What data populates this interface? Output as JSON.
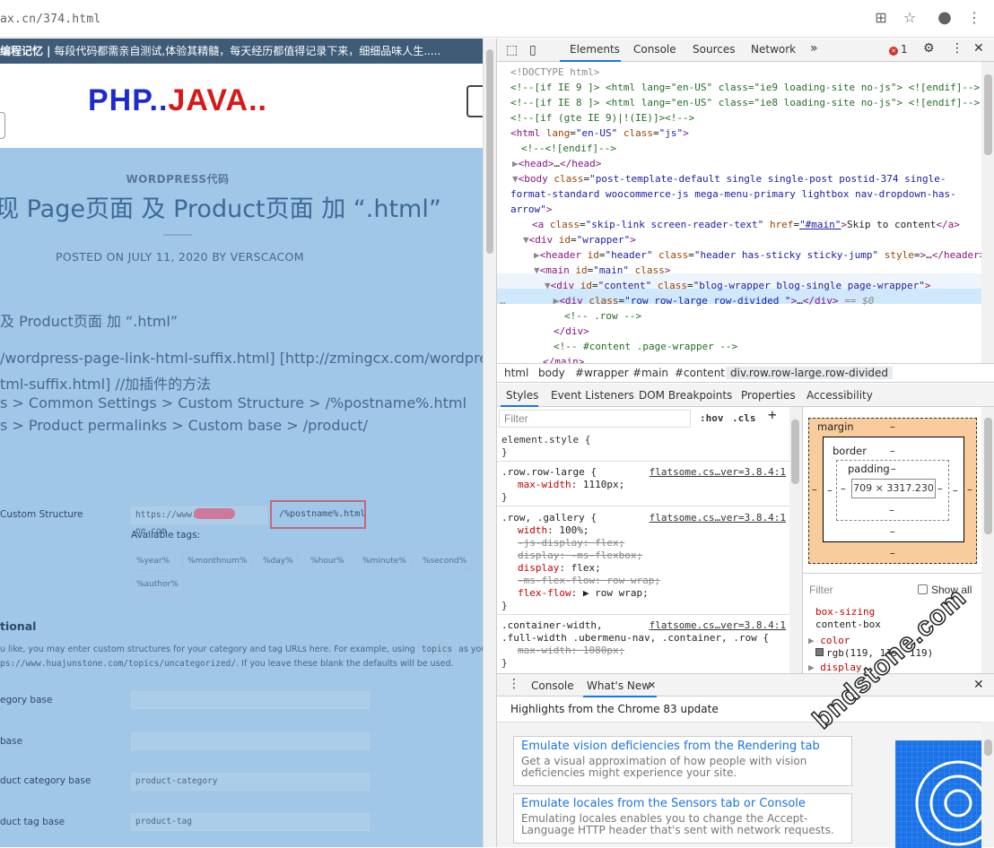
{
  "browser": {
    "url": "ax.cn/374.html"
  },
  "page": {
    "topbar_title": "编程记忆 |",
    "topbar_text": " 每段代码都需亲自测试,体验其精髓，每天经历都值得记录下来，细细品味人生.....",
    "logo_a": "PHP..",
    "logo_b": "JAVA..",
    "category": "WORDPRESS代码",
    "title": "现 Page页面 及 Product页面 加 “.html”",
    "posted": "POSTED ON JULY 11, 2020 BY VERSCACOM",
    "lines": [
      "及 Product页面 加 “.html”",
      "/wordpress-page-link-html-suffix.html] [http://zmingcx.com/wordpres",
      "tml-suffix.html] //加插件的方法",
      "s > Common Settings > Custom Structure > /%postname%.html",
      "s > Product permalinks > Custom base > /product/"
    ],
    "custom_structure_label": "Custom Structure",
    "custom_structure_value": "https://www.",
    "custom_structure_suffix": "ne.com",
    "postname_value": "/%postname%.html",
    "available_tags": "Available tags:",
    "tags": [
      "%year%",
      "%monthnum%",
      "%day%",
      "%hour%",
      "%minute%",
      "%second%",
      "%author%"
    ],
    "optional_heading": "tional",
    "optional_desc1": "u like, you may enter custom structures for your category and tag URLs here. For example, using",
    "optional_code": "topics",
    "optional_desc1b": "as your category",
    "optional_desc2": "ps://www.huajunstone.com/topics/uncategorized/",
    "optional_desc2b": ". If you leave these blank the defaults will be used.",
    "fields": [
      {
        "label": "egory base",
        "value": ""
      },
      {
        "label": "base",
        "value": ""
      },
      {
        "label": "duct category base",
        "value": "product-category"
      },
      {
        "label": "duct tag base",
        "value": "product-tag"
      }
    ]
  },
  "devtools": {
    "tabs": [
      "Elements",
      "Console",
      "Sources",
      "Network",
      "»"
    ],
    "error_count": "1",
    "dom": [
      {
        "html": "<span class='gr'>&lt;!DOCTYPE html&gt;</span>"
      },
      {
        "text": "<!--[if IE 9 ]> <html lang=\"en-US\" class=\"ie9 loading-site no-js\"> <![endif]-->"
      },
      {
        "text": "<!--[if IE 8 ]> <html lang=\"en-US\" class=\"ie8 loading-site no-js\"> <![endif]-->"
      },
      {
        "text": "<!--[if (gte IE 9)|!(IE)]><!-->"
      }
    ],
    "crumbs": [
      "html",
      "body",
      "#wrapper",
      "#main",
      "#content",
      "div.row.row-large.row-divided"
    ],
    "subtabs": [
      "Styles",
      "Event Listeners",
      "DOM Breakpoints",
      "Properties",
      "Accessibility"
    ],
    "filter_placeholder": "Filter",
    "hov": ":hov",
    "cls": ".cls",
    "plus": "+",
    "element_style": "element.style {",
    "rule1_sel": ".row.row-large {",
    "rule1_src": "flatsome.cs…ver=3.8.4:1",
    "rule1_props": [
      {
        "n": "max-width",
        "v": "1110px;"
      }
    ],
    "rule2_sel": ".row, .gallery {",
    "rule2_src": "flatsome.cs…ver=3.8.4:1",
    "rule3_sel1": ".container-width,",
    "rule3_sel2": ".full-width .ubermenu-nav, .container, .row {",
    "rule3_src": "flatsome.cs…ver=3.8.4:1",
    "rule3_prop": "max-width: 1080px;",
    "box": {
      "margin": "margin",
      "border": "border",
      "padding": "padding",
      "dash": "–",
      "content": "709 × 3317.230"
    },
    "computed_filter": "Filter",
    "show_all": "Show all",
    "computed": [
      {
        "n": "box-sizing",
        "v": "content-box"
      },
      {
        "n": "color",
        "v": "rgb(119, 119, 119)",
        "swatch": "#777777"
      },
      {
        "n": "display",
        "v": ""
      }
    ],
    "drawer_tabs": [
      "Console",
      "What's New"
    ],
    "highlights": "Highlights from the Chrome 83 update",
    "cards": [
      {
        "title": "Emulate vision deficiencies from the Rendering tab",
        "desc": "Get a visual approximation of how people with vision deficiencies might experience your site."
      },
      {
        "title": "Emulate locales from the Sensors tab or Console",
        "desc": "Emulating locales enables you to change the Accept-Language HTTP header that's sent with network requests."
      }
    ]
  },
  "watermark": "bndstone.com"
}
